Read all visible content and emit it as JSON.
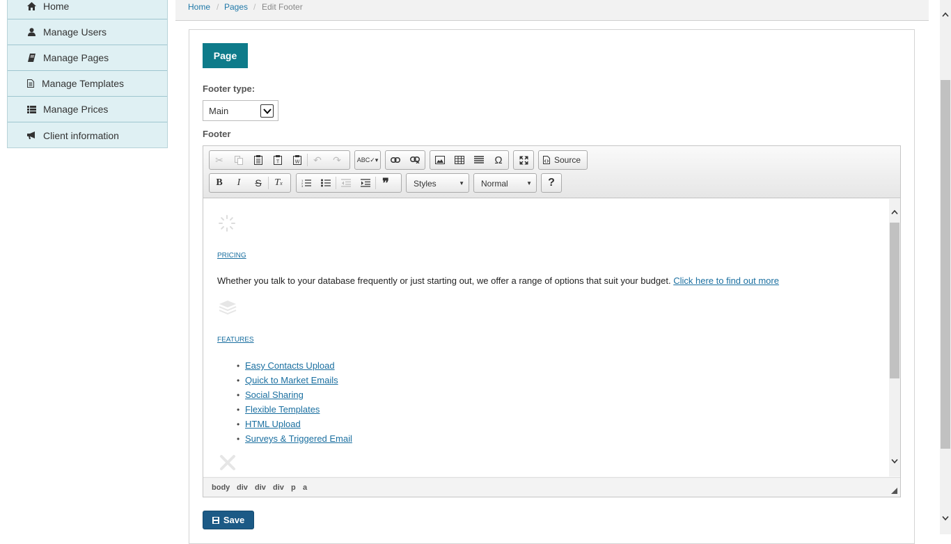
{
  "sidebar": {
    "items": [
      {
        "label": "Home",
        "icon": "home-icon"
      },
      {
        "label": "Manage Users",
        "icon": "user-icon"
      },
      {
        "label": "Manage Pages",
        "icon": "book-icon"
      },
      {
        "label": "Manage Templates",
        "icon": "file-icon"
      },
      {
        "label": "Manage Prices",
        "icon": "list-icon"
      },
      {
        "label": "Client information",
        "icon": "bullhorn-icon"
      }
    ]
  },
  "breadcrumb": {
    "home": "Home",
    "pages": "Pages",
    "current": "Edit Footer",
    "separator": "/"
  },
  "tab": {
    "label": "Page"
  },
  "form": {
    "footer_type_label": "Footer type:",
    "footer_type_value": "Main",
    "footer_label": "Footer",
    "save_label": "Save"
  },
  "toolbar": {
    "source_label": "Source",
    "styles_label": "Styles",
    "format_label": "Normal",
    "help_label": "?"
  },
  "content": {
    "pricing_heading": "PRICING",
    "pricing_text": "Whether you talk to your database frequently or just starting out, we offer a range of options that suit your budget.",
    "pricing_link": "Click here to find out more",
    "features_heading": "FEATURES",
    "features": [
      "Easy Contacts Upload",
      "Quick to Market Emails",
      "Social Sharing",
      "Flexible Templates",
      "HTML Upload",
      "Surveys & Triggered Email"
    ]
  },
  "path": [
    "body",
    "div",
    "div",
    "div",
    "p",
    "a"
  ],
  "colors": {
    "accent": "#0e7b8a",
    "save": "#1c5a86",
    "link": "#1a6fa0",
    "sidebar": "#dff0f3"
  }
}
